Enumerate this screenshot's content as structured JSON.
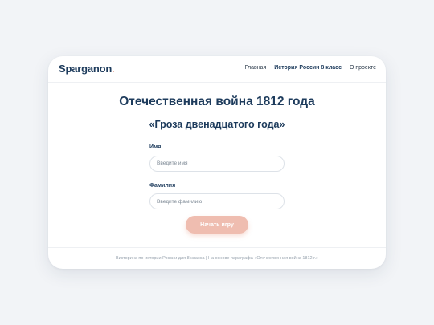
{
  "header": {
    "logo": "Sparganon",
    "logo_dot": ".",
    "nav": [
      {
        "label": "Главная"
      },
      {
        "label": "История России 8 класс"
      },
      {
        "label": "О проекте"
      }
    ]
  },
  "main": {
    "title": "Отечественная война 1812 года",
    "subtitle": "«Гроза двенадцатого года»",
    "form": {
      "first_name": {
        "label": "Имя",
        "placeholder": "Введите имя",
        "value": ""
      },
      "last_name": {
        "label": "Фамилия",
        "placeholder": "Введите фамилию",
        "value": ""
      },
      "submit_label": "Начать игру"
    }
  },
  "footer": {
    "text": "Викторина по истории России для 8 класса | На основе параграфа «Отечественная война 1812 г.»"
  },
  "colors": {
    "brand": "#1d3b5c",
    "accent": "#efbdb0",
    "background": "#f2f4f7"
  }
}
